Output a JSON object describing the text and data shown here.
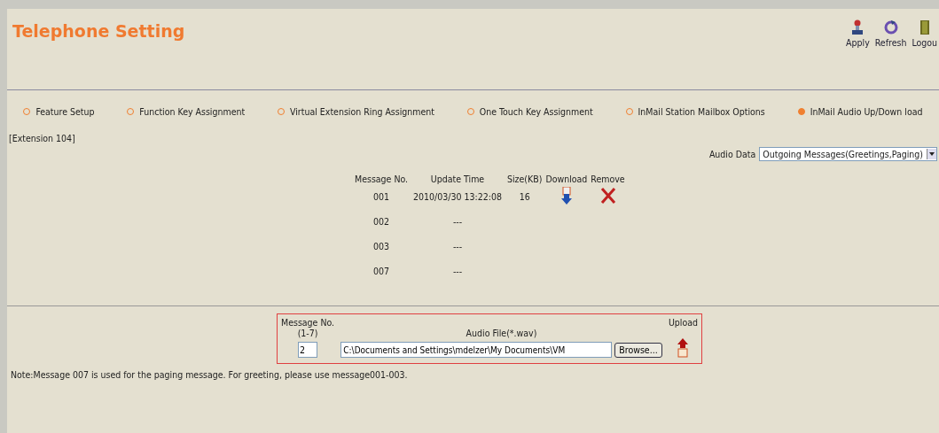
{
  "header": {
    "title": "Telephone Setting",
    "actions": [
      {
        "kind": "apply",
        "label": "Apply"
      },
      {
        "kind": "refresh",
        "label": "Refresh"
      },
      {
        "kind": "logout",
        "label": "Logou"
      }
    ]
  },
  "tabs": [
    {
      "label": "Feature Setup",
      "selected": false
    },
    {
      "label": "Function Key Assignment",
      "selected": false
    },
    {
      "label": "Virtual Extension Ring Assignment",
      "selected": false
    },
    {
      "label": "One Touch Key Assignment",
      "selected": false
    },
    {
      "label": "InMail Station Mailbox Options",
      "selected": false
    },
    {
      "label": "InMail Audio Up/Down load",
      "selected": true
    }
  ],
  "extension": "[Extension 104]",
  "audio_data": {
    "label": "Audio Data",
    "value": "Outgoing Messages(Greetings,Paging)"
  },
  "table": {
    "columns": [
      "Message No.",
      "Update Time",
      "Size(KB)",
      "Download",
      "Remove"
    ],
    "rows": [
      {
        "kind": "recorded",
        "number": "001",
        "time": "2010/03/30 13:22:08",
        "size": "16"
      },
      {
        "kind": "empty",
        "number": "002",
        "time": "---"
      },
      {
        "kind": "empty",
        "number": "003",
        "time": "---"
      },
      {
        "kind": "empty",
        "number": "007",
        "time": "---"
      }
    ]
  },
  "upload": {
    "number_label": "Message No.\n(1-7)",
    "file_label": "Audio File(*.wav)",
    "upload_label": "Upload",
    "number_value": "2",
    "file_value": "C:\\Documents and Settings\\mdelzer\\My Documents\\VM",
    "browse": "Browse..."
  },
  "note": "Note:Message 007 is used for the paging message. For greeting, please use message001-003."
}
